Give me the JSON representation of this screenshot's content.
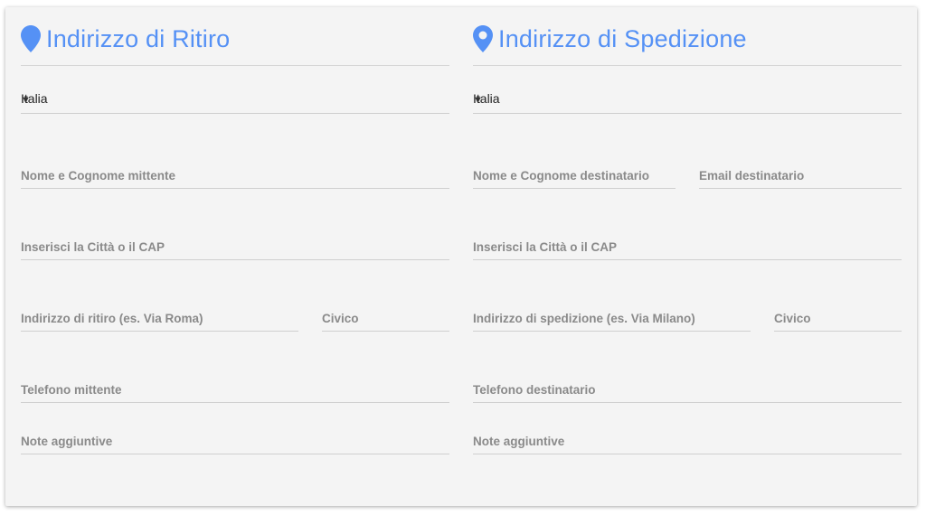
{
  "pickup": {
    "title": "Indirizzo di Ritiro",
    "country": "Italia",
    "name_placeholder": "Nome e Cognome mittente",
    "city_placeholder": "Inserisci la Città o il CAP",
    "address_placeholder": "Indirizzo di ritiro (es. Via Roma)",
    "civic_placeholder": "Civico",
    "phone_placeholder": "Telefono mittente",
    "notes_placeholder": "Note aggiuntive"
  },
  "shipping": {
    "title": "Indirizzo di Spedizione",
    "country": "Italia",
    "name_placeholder": "Nome e Cognome destinatario",
    "email_placeholder": "Email destinatario",
    "city_placeholder": "Inserisci la Città o il CAP",
    "address_placeholder": "Indirizzo di spedizione (es. Via Milano)",
    "civic_placeholder": "Civico",
    "phone_placeholder": "Telefono destinatario",
    "notes_placeholder": "Note aggiuntive"
  },
  "icons": {
    "heading": "map-pin-icon",
    "dropdown": "dropdown-arrow-icon"
  },
  "colors": {
    "accent": "#5591f5",
    "background": "#f4f4f4"
  }
}
